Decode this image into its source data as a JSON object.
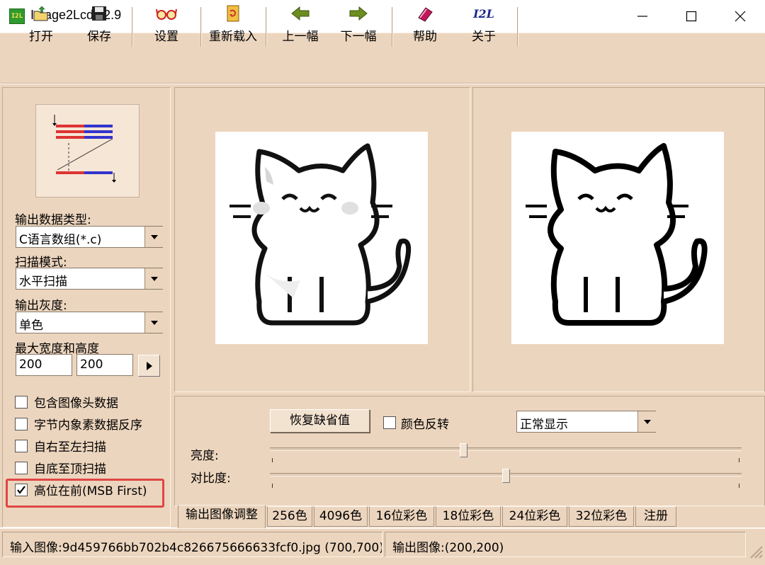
{
  "window": {
    "title": "Image2Lcd v2.9",
    "icon_text": "I2L"
  },
  "toolbar": {
    "open": "打开",
    "save": "保存",
    "settings": "设置",
    "reload": "重新载入",
    "prev": "上一幅",
    "next": "下一幅",
    "help": "帮助",
    "about": "关于",
    "about_icon_text": "I2L"
  },
  "left": {
    "output_type_label": "输出数据类型:",
    "output_type_value": "C语言数组(*.c)",
    "scan_mode_label": "扫描模式:",
    "scan_mode_value": "水平扫描",
    "gray_label": "输出灰度:",
    "gray_value": "单色",
    "max_size_label": "最大宽度和高度",
    "max_width": "200",
    "max_height": "200",
    "options": [
      {
        "label": "包含图像头数据",
        "checked": false
      },
      {
        "label": "字节内象素数据反序",
        "checked": false
      },
      {
        "label": "自右至左扫描",
        "checked": false
      },
      {
        "label": "自底至顶扫描",
        "checked": false
      },
      {
        "label": "高位在前(MSB First)",
        "checked": true
      }
    ],
    "highlight_color": "#e04545"
  },
  "adjust": {
    "restore_label": "恢复缺省值",
    "invert_label": "颜色反转",
    "invert_checked": false,
    "display_mode": "正常显示",
    "brightness_label": "亮度:",
    "contrast_label": "对比度:",
    "brightness_level": 0.5,
    "contrast_level": 0.5
  },
  "tabs": [
    "输出图像调整",
    "256色",
    "4096色",
    "16位彩色",
    "18位彩色",
    "24位彩色",
    "32位彩色",
    "注册"
  ],
  "status": {
    "input_label": "输入图像:",
    "input_value": "9d459766bb702b4c826675666633fcf0.jpg (700,700)",
    "output_label": "输出图像:",
    "output_value": "(200,200)"
  },
  "colors": {
    "background": "#ecd5be",
    "accent_green": "#2f9a2f"
  }
}
